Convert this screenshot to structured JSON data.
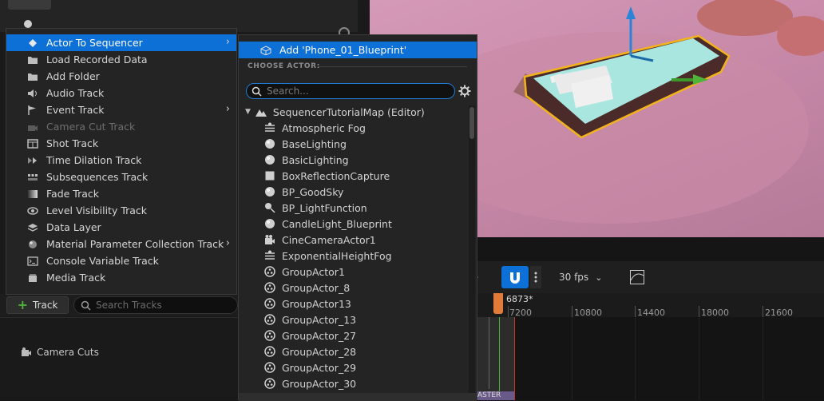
{
  "main_menu": {
    "items": [
      {
        "label": "Actor To Sequencer",
        "icon": "actor-diamond-icon",
        "selected": true,
        "submenu": true
      },
      {
        "label": "Load Recorded Data",
        "icon": "folder-icon"
      },
      {
        "label": "Add Folder",
        "icon": "folder-icon"
      },
      {
        "label": "Audio Track",
        "icon": "audio-icon"
      },
      {
        "label": "Event Track",
        "icon": "flag-icon",
        "submenu": true
      },
      {
        "label": "Camera Cut Track",
        "icon": "camera-cut-icon",
        "disabled": true
      },
      {
        "label": "Shot Track",
        "icon": "shot-icon"
      },
      {
        "label": "Time Dilation Track",
        "icon": "time-dilation-icon"
      },
      {
        "label": "Subsequences Track",
        "icon": "subsequence-icon"
      },
      {
        "label": "Fade Track",
        "icon": "fade-icon"
      },
      {
        "label": "Level Visibility Track",
        "icon": "eye-icon"
      },
      {
        "label": "Data Layer",
        "icon": "layers-icon"
      },
      {
        "label": "Material Parameter Collection Track",
        "icon": "material-icon",
        "submenu": true
      },
      {
        "label": "Console Variable Track",
        "icon": "console-icon"
      },
      {
        "label": "Media Track",
        "icon": "media-icon"
      }
    ]
  },
  "submenu": {
    "add_label": "Add 'Phone_01_Blueprint'",
    "choose_header": "CHOOSE ACTOR:",
    "search_placeholder": "Search...",
    "map_label": "SequencerTutorialMap (Editor)",
    "actors": [
      {
        "label": "Atmospheric Fog",
        "icon": "fog-icon"
      },
      {
        "label": "BaseLighting",
        "icon": "sphere-icon"
      },
      {
        "label": "BasicLighting",
        "icon": "sphere-icon"
      },
      {
        "label": "BoxReflectionCapture",
        "icon": "box-icon"
      },
      {
        "label": "BP_GoodSky",
        "icon": "sphere-icon"
      },
      {
        "label": "BP_LightFunction",
        "icon": "light-icon"
      },
      {
        "label": "CandleLight_Blueprint",
        "icon": "sphere-icon"
      },
      {
        "label": "CineCameraActor1",
        "icon": "camera-icon"
      },
      {
        "label": "ExponentialHeightFog",
        "icon": "fog-icon"
      },
      {
        "label": "GroupActor1",
        "icon": "group-icon"
      },
      {
        "label": "GroupActor_8",
        "icon": "group-icon"
      },
      {
        "label": "GroupActor13",
        "icon": "group-icon"
      },
      {
        "label": "GroupActor_13",
        "icon": "group-icon"
      },
      {
        "label": "GroupActor_27",
        "icon": "group-icon"
      },
      {
        "label": "GroupActor_28",
        "icon": "group-icon"
      },
      {
        "label": "GroupActor_29",
        "icon": "group-icon"
      },
      {
        "label": "GroupActor_30",
        "icon": "group-icon"
      }
    ]
  },
  "track_bar": {
    "add_label": "Track",
    "search_placeholder": "Search Tracks"
  },
  "tracks": [
    {
      "label": "Camera Cuts",
      "icon": "camera-icon"
    }
  ],
  "sequencer": {
    "fps": "30 fps",
    "current_frame": "6873*",
    "ticks": [
      "7200",
      "10800",
      "14400",
      "18000",
      "21600"
    ],
    "master_label": "ASTER"
  },
  "colors": {
    "selection": "#0c70d6",
    "selection_outline": "#f2b21b",
    "playhead": "#e07b39"
  }
}
